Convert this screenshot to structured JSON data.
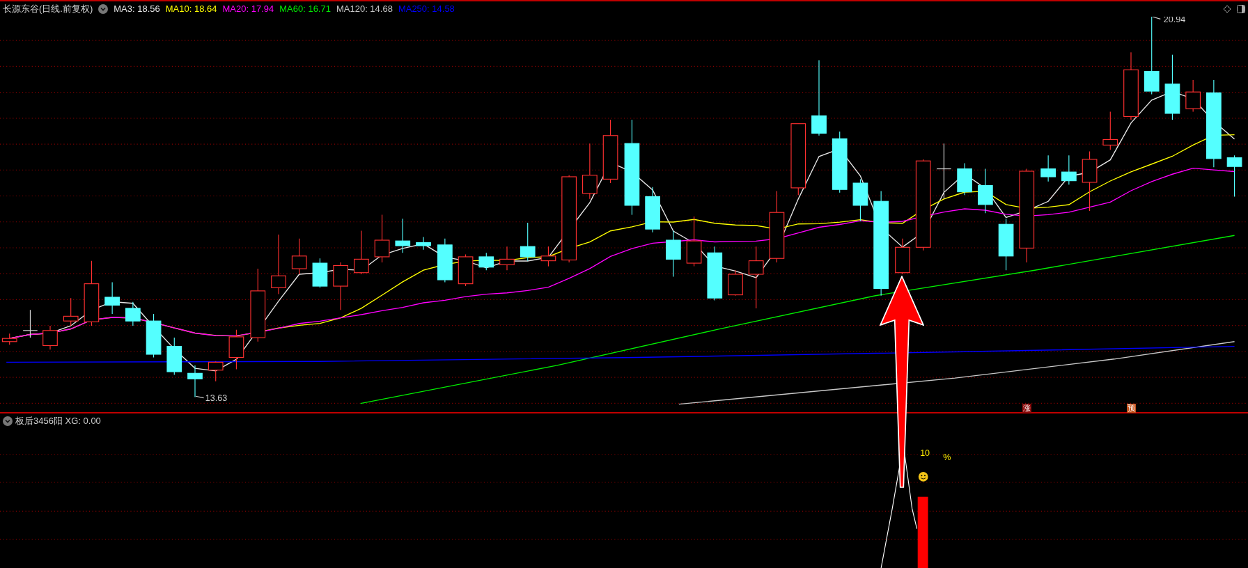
{
  "main_panel": {
    "title": "长源东谷(日线.前复权)",
    "indicators": [
      {
        "label": "MA3: 18.56",
        "color": "#e6e6e6"
      },
      {
        "label": "MA10: 18.64",
        "color": "#ffff00"
      },
      {
        "label": "MA20: 17.94",
        "color": "#ff00ff"
      },
      {
        "label": "MA60: 16.71",
        "color": "#00ee00"
      },
      {
        "label": "MA120: 14.68",
        "color": "#c8c8c8"
      },
      {
        "label": "MA250: 14.58",
        "color": "#0000ff"
      }
    ],
    "high_label": "20.94",
    "low_label": "13.63",
    "markers": [
      {
        "text": "涨",
        "color": "#8b0a0a"
      },
      {
        "text": "预",
        "color": "#c4501a"
      }
    ]
  },
  "sub_panel": {
    "title": "板后3456阳 XG: 0.00",
    "value_label": "10",
    "unit_label": "%"
  }
}
